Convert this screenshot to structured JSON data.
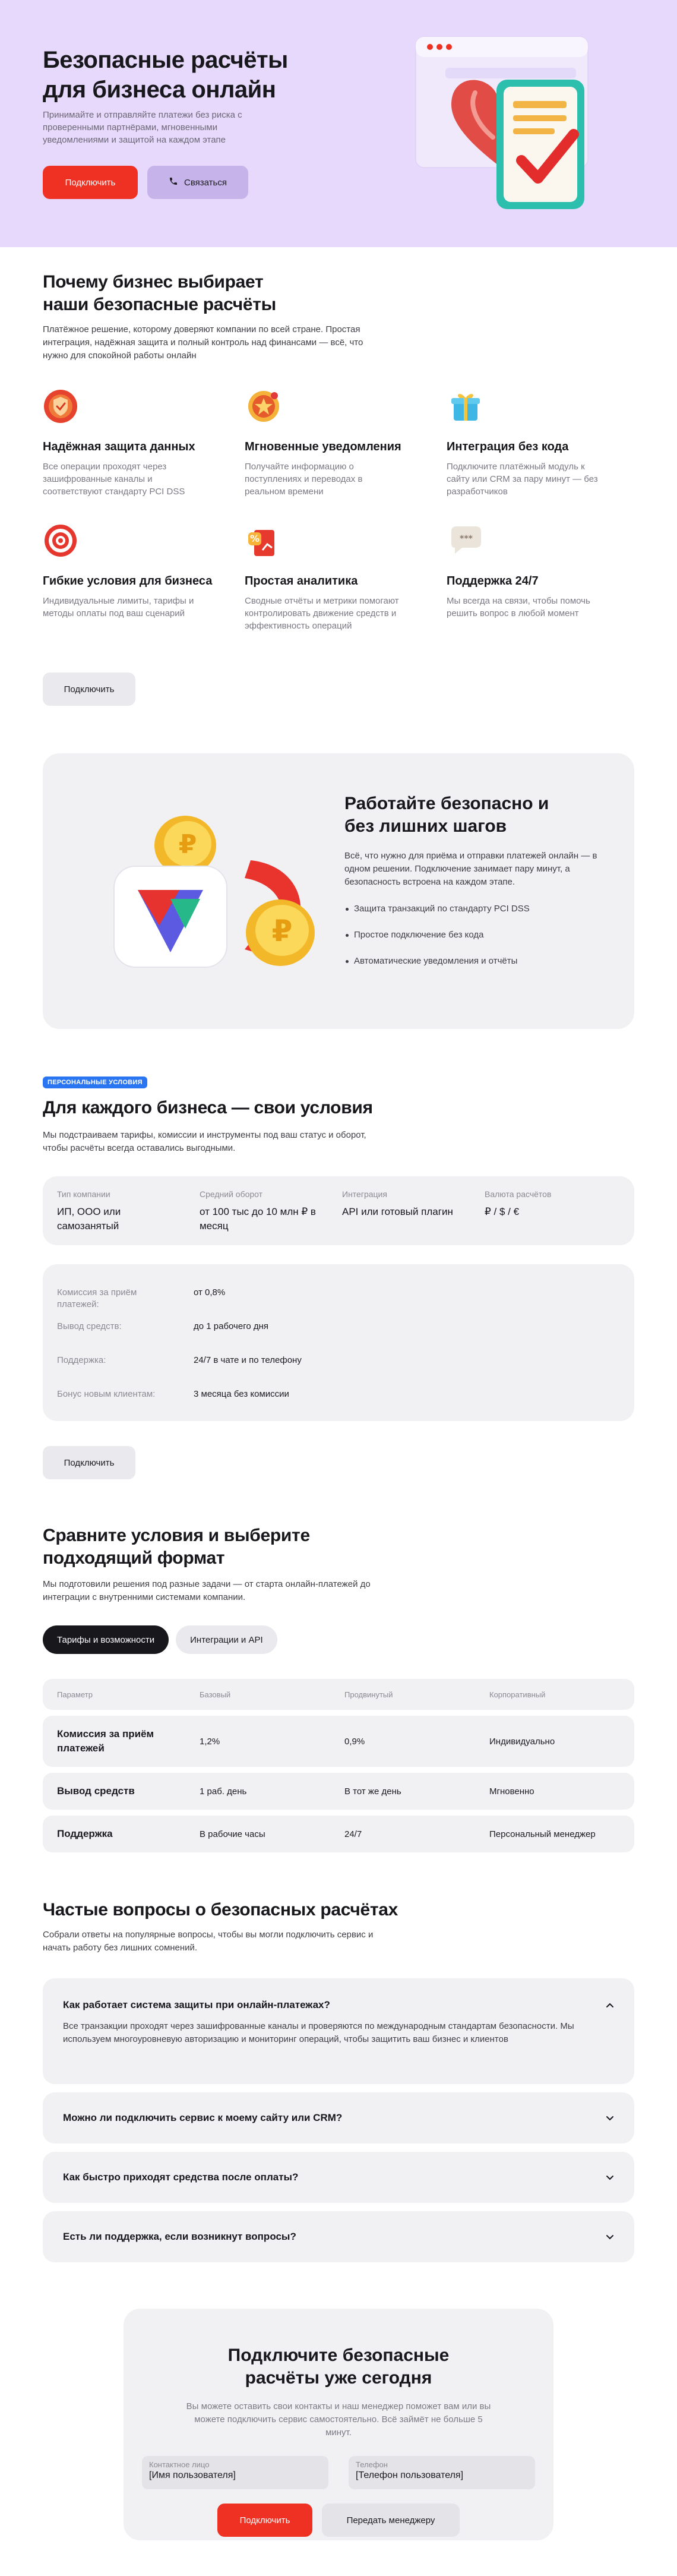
{
  "colors": {
    "accent": "#ef3124",
    "hero_bg": "#e7d9fb",
    "badge": "#2a76f2",
    "card_bg": "#f1f1f4"
  },
  "hero": {
    "title": "Безопасные расчёты для бизнеса онлайн",
    "text": "Принимайте и отправляйте платежи без риска с проверенными партнёрами, мгновенными уведомлениями и защитой на каждом этапе",
    "connect_label": "Подключить",
    "contact_label": "Связаться",
    "contact_icon": "phone-icon"
  },
  "why": {
    "title": "Почему бизнес выбирает наши безопасные расчёты",
    "text": "Платёжное решение, которому доверяют компании по всей стране. Простая интеграция, надёжная защита и полный контроль над финансами — всё, что нужно для спокойной работы онлайн",
    "features": [
      {
        "icon": "shield-icon",
        "title": "Надёжная защита данных",
        "text": "Все операции проходят через зашифрованные каналы и соответствуют стандарту PCI DSS"
      },
      {
        "icon": "bell-icon",
        "title": "Мгновенные уведомления",
        "text": "Получайте информацию о поступлениях и переводах в реальном времени"
      },
      {
        "icon": "gift-icon",
        "title": "Интеграция без кода",
        "text": "Подключите платёжный модуль к сайту или CRM за пару минут — без разработчиков"
      },
      {
        "icon": "target-icon",
        "title": "Гибкие условия для бизнеса",
        "text": "Индивидуальные лимиты, тарифы и методы оплаты под ваш сценарий"
      },
      {
        "icon": "percent-icon",
        "title": "Простая аналитика",
        "text": "Сводные отчёты и метрики помогают контролировать движение средств и эффективность операций"
      },
      {
        "icon": "chat-icon",
        "title": "Поддержка 24/7",
        "text": "Мы всегда на связи, чтобы помочь решить вопрос в любой момент"
      }
    ],
    "button_label": "Подключить"
  },
  "promo": {
    "title": "Работайте безопасно и без лишних шагов",
    "text": "Всё, что нужно для приёма и отправки платежей онлайн — в одном решении. Подключение занимает пару минут, а безопасность встроена на каждом этапе.",
    "bullets": [
      "Защита транзакций по стандарту PCI DSS",
      "Простое подключение без кода",
      "Автоматические уведомления и отчёты"
    ]
  },
  "conditions": {
    "badge": "ПЕРСОНАЛЬНЫЕ УСЛОВИЯ",
    "title": "Для каждого бизнеса — свои условия",
    "text": "Мы подстраиваем тарифы, комиссии и инструменты под ваш статус и оборот, чтобы расчёты всегда оставались выгодными.",
    "params": [
      {
        "label": "Тип компании",
        "value": "ИП, ООО или самозанятый"
      },
      {
        "label": "Средний оборот",
        "value": "от 100 тыс до 10 млн ₽ в месяц"
      },
      {
        "label": "Интеграция",
        "value": "API или готовый плагин"
      },
      {
        "label": "Валюта расчётов",
        "value": "₽ / $ / €"
      }
    ],
    "rows": [
      {
        "key": "Комиссия за приём платежей:",
        "value": "от 0,8%"
      },
      {
        "key": "Вывод средств:",
        "value": "до 1 рабочего дня"
      },
      {
        "key": "Поддержка:",
        "value": "24/7 в чате и по телефону"
      },
      {
        "key": "Бонус новым клиентам:",
        "value": "3 месяца без комиссии"
      }
    ],
    "button_label": "Подключить"
  },
  "compare": {
    "title": "Сравните условия и выберите подходящий формат",
    "text": "Мы подготовили решения под разные задачи — от старта онлайн-платежей до интеграции с внутренними системами компании.",
    "tabs": [
      "Тарифы и возможности",
      "Интеграции и API"
    ],
    "headers": [
      "Параметр",
      "Базовый",
      "Продвинутый",
      "Корпоративный"
    ],
    "rows": [
      {
        "param": "Комиссия за приём платежей",
        "basic": "1,2%",
        "advanced": "0,9%",
        "corporate": "Индивидуально"
      },
      {
        "param": "Вывод средств",
        "basic": "1 раб. день",
        "advanced": "В тот же день",
        "corporate": "Мгновенно"
      },
      {
        "param": "Поддержка",
        "basic": "В рабочие часы",
        "advanced": "24/7",
        "corporate": "Персональный менеджер"
      }
    ]
  },
  "faq": {
    "title": "Частые вопросы о безопасных расчётах",
    "text": "Собрали ответы на популярные вопросы, чтобы вы могли подключить сервис и начать работу без лишних сомнений.",
    "items": [
      {
        "q": "Как работает система защиты при онлайн-платежах?",
        "a": "Все транзакции проходят через зашифрованные каналы и проверяются по международным стандартам безопасности. Мы используем многоуровневую авторизацию и мониторинг операций, чтобы защитить ваш бизнес и клиентов"
      },
      {
        "q": "Можно ли подключить сервис к моему сайту или CRM?"
      },
      {
        "q": "Как быстро приходят средства после оплаты?"
      },
      {
        "q": "Есть ли поддержка, если возникнут вопросы?"
      }
    ]
  },
  "cta": {
    "title": "Подключите безопасные расчёты уже сегодня",
    "text": "Вы можете оставить свои контакты и наш менеджер поможет вам или вы можете подключить сервис самостоятельно. Всё займёт не больше 5 минут.",
    "contact_label": "Контактное лицо",
    "contact_value": "[Имя пользователя]",
    "phone_label": "Телефон",
    "phone_value": "[Телефон пользователя]",
    "connect_label": "Подключить",
    "manager_label": "Передать менеджеру"
  }
}
